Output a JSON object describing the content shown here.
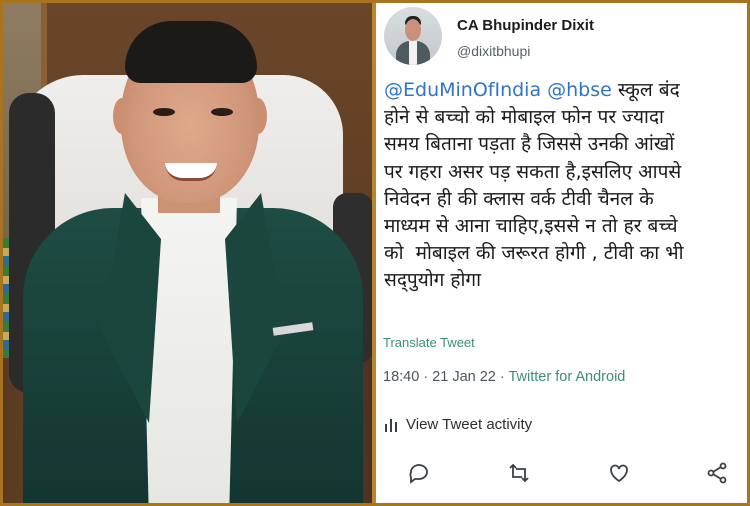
{
  "tweet": {
    "author_name": "CA Bhupinder Dixit",
    "handle": "@dixitbhupi",
    "mention_1": "@EduMinOfIndia",
    "mention_2": "@hbse",
    "line_1_rest": " स्कूल बंद",
    "line_2": "होने से बच्चो को मोबाइल फोन पर ज्यादा",
    "line_3": "समय बिताना पड़ता है जिससे उनकी आंखों",
    "line_4": "पर गहरा असर पड़ सकता है,इसलिए आपसे",
    "line_5": "निवेदन ही की क्लास वर्क टीवी चैनल के",
    "line_6": "माध्यम से आना चाहिए,इससे न तो हर बच्चे",
    "line_7": "को  मोबाइल की जरूरत होगी , टीवी का भी",
    "line_8": "सद्पुयोग होगा",
    "translate_label": "Translate Tweet",
    "time_date": "18:40 · 21 Jan 22 · ",
    "source_app": "Twitter for Android",
    "activity_label": "View Tweet activity"
  },
  "icons": {
    "reply": "reply-icon",
    "retweet": "retweet-icon",
    "like": "like-icon",
    "share": "share-icon",
    "activity": "bar-chart-icon"
  },
  "colors": {
    "frame": "#b9862f",
    "mention": "#2f74c9",
    "link_green": "#3a8f78"
  }
}
